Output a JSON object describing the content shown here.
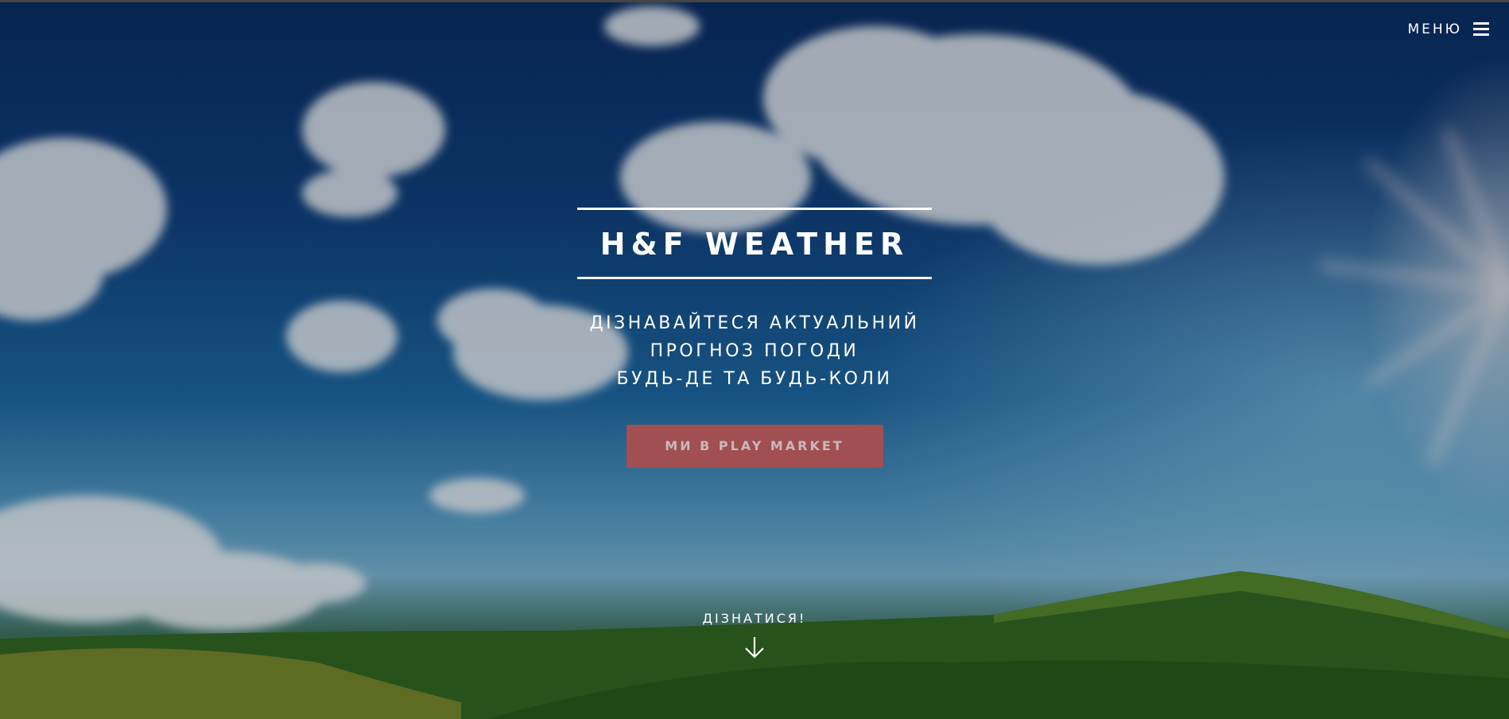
{
  "header": {
    "menu_label": "МЕНЮ"
  },
  "hero": {
    "title": "H&F WEATHER",
    "tagline": [
      "ДІЗНАВАЙТЕСЯ АКТУАЛЬНИЙ",
      "ПРОГНОЗ ПОГОДИ",
      "БУДЬ-ДЕ ТА БУДЬ-КОЛИ"
    ],
    "cta_label": "МИ В PLAY MARKET"
  },
  "scroll_hint": {
    "label": "ДІЗНАТИСЯ!",
    "icon": "arrow-down-icon"
  },
  "colors": {
    "cta_background": "#a14f50",
    "cta_text": "#c9b8bf",
    "text": "#ffffff"
  }
}
